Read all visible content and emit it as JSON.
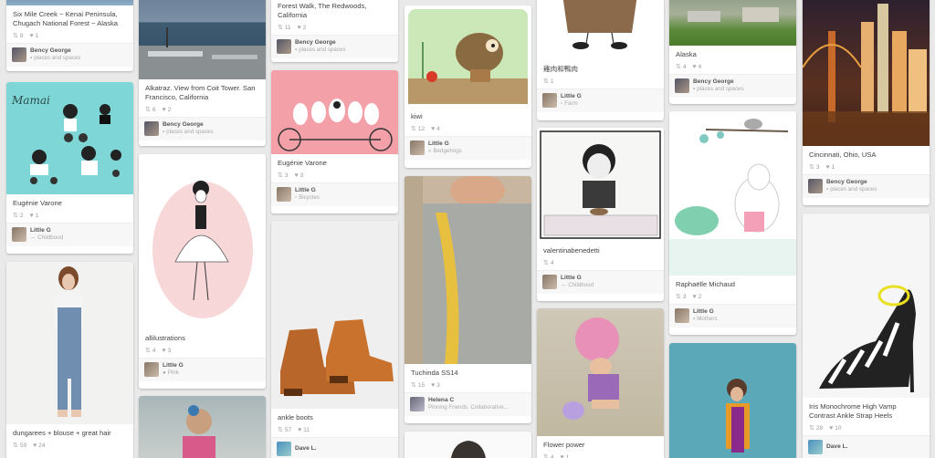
{
  "pins": {
    "p1": {
      "desc": "Six Mile Creek ~ Kenai Peninsula, Chugach National Forest ~ Alaska",
      "repins": "8",
      "likes": "1",
      "owner": "Bency George",
      "board": "places and spaces"
    },
    "p2": {
      "desc": "Eugénie Varone",
      "repins": "2",
      "likes": "1",
      "owner": "Little G",
      "board": "Childbood",
      "title_text": "Mamai"
    },
    "p3": {
      "desc": "dungarees + blouse + great hair",
      "repins": "59",
      "likes": "24"
    },
    "p4": {
      "desc": "Alkatraz. View from Coit Tower. San Francisco, California",
      "repins": "6",
      "likes": "2",
      "owner": "Bency George",
      "board": "places and spaces"
    },
    "p5": {
      "desc": "allilustrations",
      "repins": "4",
      "likes": "3",
      "owner": "Little G",
      "board": "Pink"
    },
    "p6": {
      "desc": "Forest Walk, The Redwoods, California",
      "repins": "11",
      "likes": "2",
      "owner": "Bency George",
      "board": "places and spaces"
    },
    "p7": {
      "desc": "Eugénie Varone",
      "repins": "3",
      "likes": "3",
      "owner": "Little G",
      "board": "Bicycles"
    },
    "p8": {
      "desc": "ankle boots",
      "repins": "57",
      "likes": "11",
      "owner": "Dave L."
    },
    "p9": {
      "desc": "kiwi",
      "repins": "12",
      "likes": "4",
      "owner": "Little G",
      "board": "Bedgehogs"
    },
    "p10": {
      "desc": "Tuchinda SS14",
      "repins": "15",
      "likes": "3",
      "owner": "Helena C",
      "board": "Pinning Friends. Collaborative..."
    },
    "p11": {
      "desc": "雞肉和鴨肉",
      "repins": "1",
      "owner": "Little G",
      "board": "Farm"
    },
    "p12": {
      "desc": "valentinabenedetti",
      "repins": "4",
      "owner": "Little G",
      "board": "Childbood"
    },
    "p13": {
      "desc": "Flower power",
      "repins": "4",
      "likes": "1"
    },
    "p14": {
      "desc": "Alaska",
      "repins": "4",
      "likes": "4",
      "owner": "Bency George",
      "board": "places and spaces"
    },
    "p15": {
      "desc": "Raphaëlle Michaud",
      "repins": "3",
      "likes": "2",
      "owner": "Little G",
      "board": "Mothers"
    },
    "p16": {
      "desc": "Cincinnati, Ohio, USA",
      "repins": "3",
      "likes": "1",
      "owner": "Bency George",
      "board": "places and spaces"
    },
    "p17": {
      "desc": "Iris Monochrome High Vamp Contrast Ankle Strap Heels",
      "repins": "28",
      "likes": "10",
      "owner": "Dave L."
    }
  },
  "icons": {
    "repin": "repin-icon",
    "like": "heart-icon",
    "board": "board-icon"
  },
  "colors": {
    "background": "#e9e9e9",
    "card": "#ffffff",
    "owner_bar": "#f7f7f7"
  }
}
